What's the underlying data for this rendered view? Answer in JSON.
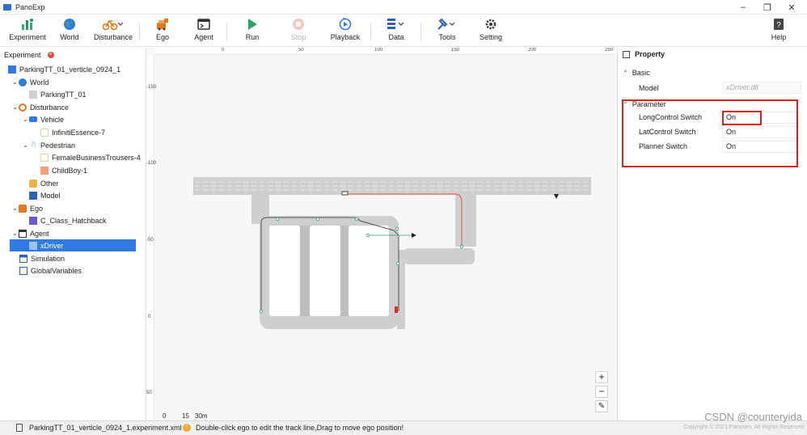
{
  "app": {
    "title": "PanoExp"
  },
  "toolbar": {
    "experiment": "Experiment",
    "world": "World",
    "disturbance": "Disturbance",
    "ego": "Ego",
    "agent": "Agent",
    "run": "Run",
    "stop": "Stop",
    "playback": "Playback",
    "data": "Data",
    "tools": "Tools",
    "setting": "Setting",
    "help": "Help"
  },
  "tree": {
    "header": "Experiment",
    "items": [
      {
        "label": "ParkingTT_01_verticle_0924_1"
      },
      {
        "label": "World"
      },
      {
        "label": "ParkingTT_01"
      },
      {
        "label": "Disturbance"
      },
      {
        "label": "Vehicle"
      },
      {
        "label": "InfinitiEssence-7"
      },
      {
        "label": "Pedestrian"
      },
      {
        "label": "FemaleBusinessTrousers-4"
      },
      {
        "label": "ChildBoy-1"
      },
      {
        "label": "Other"
      },
      {
        "label": "Model"
      },
      {
        "label": "Ego"
      },
      {
        "label": "C_Class_Hatchback"
      },
      {
        "label": "Agent"
      },
      {
        "label": "xDriver"
      },
      {
        "label": "Simulation"
      },
      {
        "label": "GlobalVariables"
      }
    ]
  },
  "canvas": {
    "ruler_x": [
      "0",
      "50",
      "100",
      "150",
      "200",
      "250"
    ],
    "ruler_y": [
      "-150",
      "-100",
      "-50",
      "0",
      "50"
    ],
    "zoom_in": "+",
    "zoom_out": "−",
    "scale_labels": [
      "0",
      "15",
      "30m"
    ]
  },
  "property": {
    "title": "Property",
    "basic_section": "Basic",
    "model_label": "Model",
    "model_value": "xDriver.dll",
    "parameter_section": "Parameter",
    "params": [
      {
        "label": "LongControl Switch",
        "value": "On"
      },
      {
        "label": "LatControl Switch",
        "value": "On"
      },
      {
        "label": "Planner Switch",
        "value": "On"
      }
    ]
  },
  "status": {
    "file": "ParkingTT_01_verticle_0924_1.experiment.xml",
    "hint": "Double-click ego to edit the track line,Drag to move ego position!"
  },
  "footer": {
    "watermark": "CSDN @counteryida",
    "copyright": "Copyright © 2021 Panosim. All Rights Reserved"
  },
  "colors": {
    "accent": "#2f7ae5",
    "highlight_box": "#d91f26",
    "trajectory": "#e05050"
  }
}
